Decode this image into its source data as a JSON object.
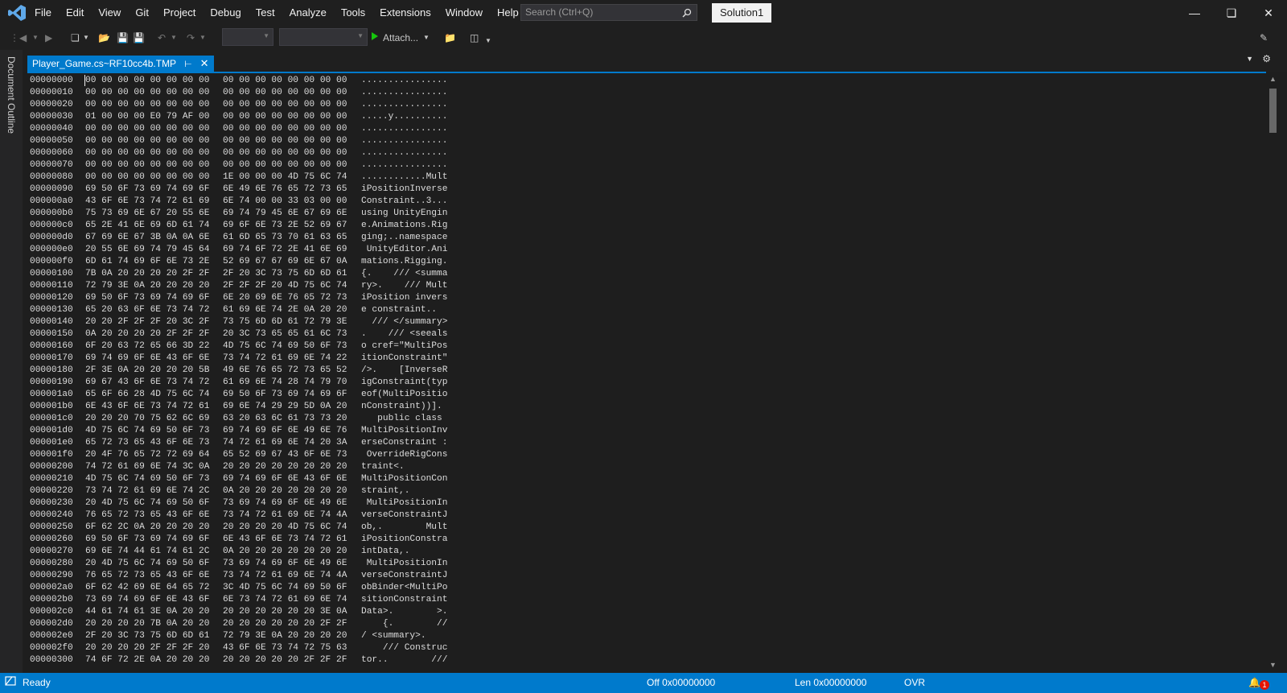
{
  "menu": [
    "File",
    "Edit",
    "View",
    "Git",
    "Project",
    "Debug",
    "Test",
    "Analyze",
    "Tools",
    "Extensions",
    "Window",
    "Help"
  ],
  "search": {
    "placeholder": "Search (Ctrl+Q)"
  },
  "solution_label": "Solution1",
  "toolbar": {
    "attach_label": "Attach...",
    "attach_color": "#16c60c"
  },
  "side_rail_label": "Document Outline",
  "tab": {
    "title": "Player_Game.cs~RF10cc4b.TMP"
  },
  "hex_rows": [
    {
      "addr": "00000000",
      "h1": "00 00 00 00 00 00 00 00",
      "h2": "00 00 00 00 00 00 00 00",
      "ascii": "................"
    },
    {
      "addr": "00000010",
      "h1": "00 00 00 00 00 00 00 00",
      "h2": "00 00 00 00 00 00 00 00",
      "ascii": "................"
    },
    {
      "addr": "00000020",
      "h1": "00 00 00 00 00 00 00 00",
      "h2": "00 00 00 00 00 00 00 00",
      "ascii": "................"
    },
    {
      "addr": "00000030",
      "h1": "01 00 00 00 E0 79 AF 00",
      "h2": "00 00 00 00 00 00 00 00",
      "ascii": ".....y.........."
    },
    {
      "addr": "00000040",
      "h1": "00 00 00 00 00 00 00 00",
      "h2": "00 00 00 00 00 00 00 00",
      "ascii": "................"
    },
    {
      "addr": "00000050",
      "h1": "00 00 00 00 00 00 00 00",
      "h2": "00 00 00 00 00 00 00 00",
      "ascii": "................"
    },
    {
      "addr": "00000060",
      "h1": "00 00 00 00 00 00 00 00",
      "h2": "00 00 00 00 00 00 00 00",
      "ascii": "................"
    },
    {
      "addr": "00000070",
      "h1": "00 00 00 00 00 00 00 00",
      "h2": "00 00 00 00 00 00 00 00",
      "ascii": "................"
    },
    {
      "addr": "00000080",
      "h1": "00 00 00 00 00 00 00 00",
      "h2": "1E 00 00 00 4D 75 6C 74",
      "ascii": "............Mult"
    },
    {
      "addr": "00000090",
      "h1": "69 50 6F 73 69 74 69 6F",
      "h2": "6E 49 6E 76 65 72 73 65",
      "ascii": "iPositionInverse"
    },
    {
      "addr": "000000a0",
      "h1": "43 6F 6E 73 74 72 61 69",
      "h2": "6E 74 00 00 33 03 00 00",
      "ascii": "Constraint..3..."
    },
    {
      "addr": "000000b0",
      "h1": "75 73 69 6E 67 20 55 6E",
      "h2": "69 74 79 45 6E 67 69 6E",
      "ascii": "using UnityEngin"
    },
    {
      "addr": "000000c0",
      "h1": "65 2E 41 6E 69 6D 61 74",
      "h2": "69 6F 6E 73 2E 52 69 67",
      "ascii": "e.Animations.Rig"
    },
    {
      "addr": "000000d0",
      "h1": "67 69 6E 67 3B 0A 0A 6E",
      "h2": "61 6D 65 73 70 61 63 65",
      "ascii": "ging;..namespace"
    },
    {
      "addr": "000000e0",
      "h1": "20 55 6E 69 74 79 45 64",
      "h2": "69 74 6F 72 2E 41 6E 69",
      "ascii": " UnityEditor.Ani"
    },
    {
      "addr": "000000f0",
      "h1": "6D 61 74 69 6F 6E 73 2E",
      "h2": "52 69 67 67 69 6E 67 0A",
      "ascii": "mations.Rigging."
    },
    {
      "addr": "00000100",
      "h1": "7B 0A 20 20 20 20 2F 2F",
      "h2": "2F 20 3C 73 75 6D 6D 61",
      "ascii": "{.    /// <summa"
    },
    {
      "addr": "00000110",
      "h1": "72 79 3E 0A 20 20 20 20",
      "h2": "2F 2F 2F 20 4D 75 6C 74",
      "ascii": "ry>.    /// Mult"
    },
    {
      "addr": "00000120",
      "h1": "69 50 6F 73 69 74 69 6F",
      "h2": "6E 20 69 6E 76 65 72 73",
      "ascii": "iPosition invers"
    },
    {
      "addr": "00000130",
      "h1": "65 20 63 6F 6E 73 74 72",
      "h2": "61 69 6E 74 2E 0A 20 20",
      "ascii": "e constraint.. "
    },
    {
      "addr": "00000140",
      "h1": "20 20 2F 2F 2F 20 3C 2F",
      "h2": "73 75 6D 6D 61 72 79 3E",
      "ascii": "  /// </summary>"
    },
    {
      "addr": "00000150",
      "h1": "0A 20 20 20 20 2F 2F 2F",
      "h2": "20 3C 73 65 65 61 6C 73",
      "ascii": ".    /// <seeals"
    },
    {
      "addr": "00000160",
      "h1": "6F 20 63 72 65 66 3D 22",
      "h2": "4D 75 6C 74 69 50 6F 73",
      "ascii": "o cref=\"MultiPos"
    },
    {
      "addr": "00000170",
      "h1": "69 74 69 6F 6E 43 6F 6E",
      "h2": "73 74 72 61 69 6E 74 22",
      "ascii": "itionConstraint\""
    },
    {
      "addr": "00000180",
      "h1": "2F 3E 0A 20 20 20 20 5B",
      "h2": "49 6E 76 65 72 73 65 52",
      "ascii": "/>.    [InverseR"
    },
    {
      "addr": "00000190",
      "h1": "69 67 43 6F 6E 73 74 72",
      "h2": "61 69 6E 74 28 74 79 70",
      "ascii": "igConstraint(typ"
    },
    {
      "addr": "000001a0",
      "h1": "65 6F 66 28 4D 75 6C 74",
      "h2": "69 50 6F 73 69 74 69 6F",
      "ascii": "eof(MultiPositio"
    },
    {
      "addr": "000001b0",
      "h1": "6E 43 6F 6E 73 74 72 61",
      "h2": "69 6E 74 29 29 5D 0A 20",
      "ascii": "nConstraint))]."
    },
    {
      "addr": "000001c0",
      "h1": "20 20 20 70 75 62 6C 69",
      "h2": "63 20 63 6C 61 73 73 20",
      "ascii": "   public class "
    },
    {
      "addr": "000001d0",
      "h1": "4D 75 6C 74 69 50 6F 73",
      "h2": "69 74 69 6F 6E 49 6E 76",
      "ascii": "MultiPositionInv"
    },
    {
      "addr": "000001e0",
      "h1": "65 72 73 65 43 6F 6E 73",
      "h2": "74 72 61 69 6E 74 20 3A",
      "ascii": "erseConstraint :"
    },
    {
      "addr": "000001f0",
      "h1": "20 4F 76 65 72 72 69 64",
      "h2": "65 52 69 67 43 6F 6E 73",
      "ascii": " OverrideRigCons"
    },
    {
      "addr": "00000200",
      "h1": "74 72 61 69 6E 74 3C 0A",
      "h2": "20 20 20 20 20 20 20 20",
      "ascii": "traint<.        "
    },
    {
      "addr": "00000210",
      "h1": "4D 75 6C 74 69 50 6F 73",
      "h2": "69 74 69 6F 6E 43 6F 6E",
      "ascii": "MultiPositionCon"
    },
    {
      "addr": "00000220",
      "h1": "73 74 72 61 69 6E 74 2C",
      "h2": "0A 20 20 20 20 20 20 20",
      "ascii": "straint,.       "
    },
    {
      "addr": "00000230",
      "h1": "20 4D 75 6C 74 69 50 6F",
      "h2": "73 69 74 69 6F 6E 49 6E",
      "ascii": " MultiPositionIn"
    },
    {
      "addr": "00000240",
      "h1": "76 65 72 73 65 43 6F 6E",
      "h2": "73 74 72 61 69 6E 74 4A",
      "ascii": "verseConstraintJ"
    },
    {
      "addr": "00000250",
      "h1": "6F 62 2C 0A 20 20 20 20",
      "h2": "20 20 20 20 4D 75 6C 74",
      "ascii": "ob,.        Mult"
    },
    {
      "addr": "00000260",
      "h1": "69 50 6F 73 69 74 69 6F",
      "h2": "6E 43 6F 6E 73 74 72 61",
      "ascii": "iPositionConstra"
    },
    {
      "addr": "00000270",
      "h1": "69 6E 74 44 61 74 61 2C",
      "h2": "0A 20 20 20 20 20 20 20",
      "ascii": "intData,.       "
    },
    {
      "addr": "00000280",
      "h1": "20 4D 75 6C 74 69 50 6F",
      "h2": "73 69 74 69 6F 6E 49 6E",
      "ascii": " MultiPositionIn"
    },
    {
      "addr": "00000290",
      "h1": "76 65 72 73 65 43 6F 6E",
      "h2": "73 74 72 61 69 6E 74 4A",
      "ascii": "verseConstraintJ"
    },
    {
      "addr": "000002a0",
      "h1": "6F 62 42 69 6E 64 65 72",
      "h2": "3C 4D 75 6C 74 69 50 6F",
      "ascii": "obBinder<MultiPo"
    },
    {
      "addr": "000002b0",
      "h1": "73 69 74 69 6F 6E 43 6F",
      "h2": "6E 73 74 72 61 69 6E 74",
      "ascii": "sitionConstraint"
    },
    {
      "addr": "000002c0",
      "h1": "44 61 74 61 3E 0A 20 20",
      "h2": "20 20 20 20 20 20 3E 0A",
      "ascii": "Data>.        >."
    },
    {
      "addr": "000002d0",
      "h1": "20 20 20 20 7B 0A 20 20",
      "h2": "20 20 20 20 20 20 2F 2F",
      "ascii": "    {.        //"
    },
    {
      "addr": "000002e0",
      "h1": "2F 20 3C 73 75 6D 6D 61",
      "h2": "72 79 3E 0A 20 20 20 20",
      "ascii": "/ <summary>.    "
    },
    {
      "addr": "000002f0",
      "h1": "20 20 20 20 2F 2F 2F 20",
      "h2": "43 6F 6E 73 74 72 75 63",
      "ascii": "    /// Construc"
    },
    {
      "addr": "00000300",
      "h1": "74 6F 72 2E 0A 20 20 20",
      "h2": "20 20 20 20 20 2F 2F 2F",
      "ascii": "tor..        ///"
    }
  ],
  "status": {
    "ready": "Ready",
    "offset": "Off 0x00000000",
    "length": "Len 0x00000000",
    "mode": "OVR",
    "notification_count": "1"
  }
}
